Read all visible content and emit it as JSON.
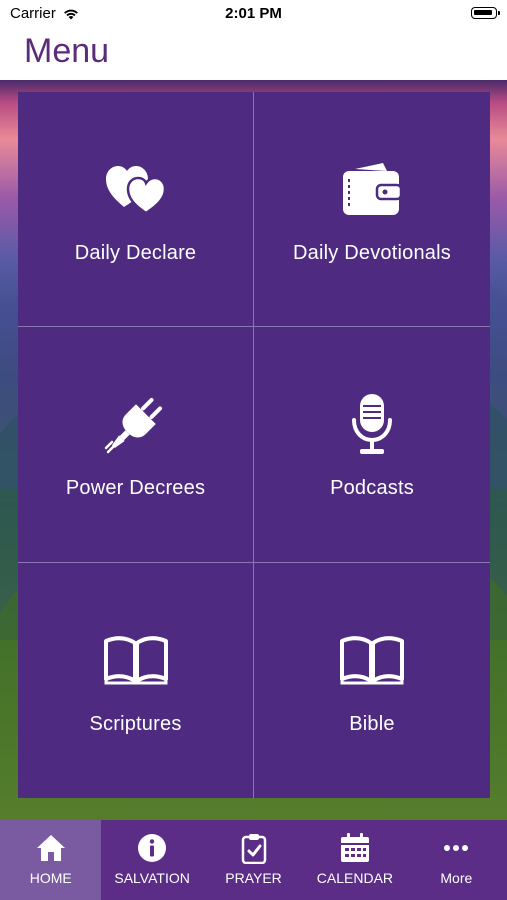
{
  "status_bar": {
    "carrier": "Carrier",
    "time": "2:01 PM"
  },
  "header": {
    "title": "Menu"
  },
  "menu": {
    "items": [
      {
        "label": "Daily Declare",
        "icon": "hearts-icon"
      },
      {
        "label": "Daily Devotionals",
        "icon": "wallet-icon"
      },
      {
        "label": "Power Decrees",
        "icon": "power-plug-icon"
      },
      {
        "label": "Podcasts",
        "icon": "microphone-icon"
      },
      {
        "label": "Scriptures",
        "icon": "open-book-icon"
      },
      {
        "label": "Bible",
        "icon": "open-book-icon"
      }
    ]
  },
  "tab_bar": {
    "tabs": [
      {
        "label": "HOME",
        "icon": "home-icon",
        "active": true
      },
      {
        "label": "SALVATION",
        "icon": "info-icon"
      },
      {
        "label": "PRAYER",
        "icon": "clipboard-check-icon"
      },
      {
        "label": "CALENDAR",
        "icon": "calendar-icon"
      },
      {
        "label": "More",
        "icon": "more-dots-icon"
      }
    ]
  },
  "colors": {
    "tile_bg": "#4e2a80",
    "tab_bar_bg": "#5b2d86",
    "active_tab_bg": "#7a5aa0",
    "title": "#5b2c7a"
  }
}
